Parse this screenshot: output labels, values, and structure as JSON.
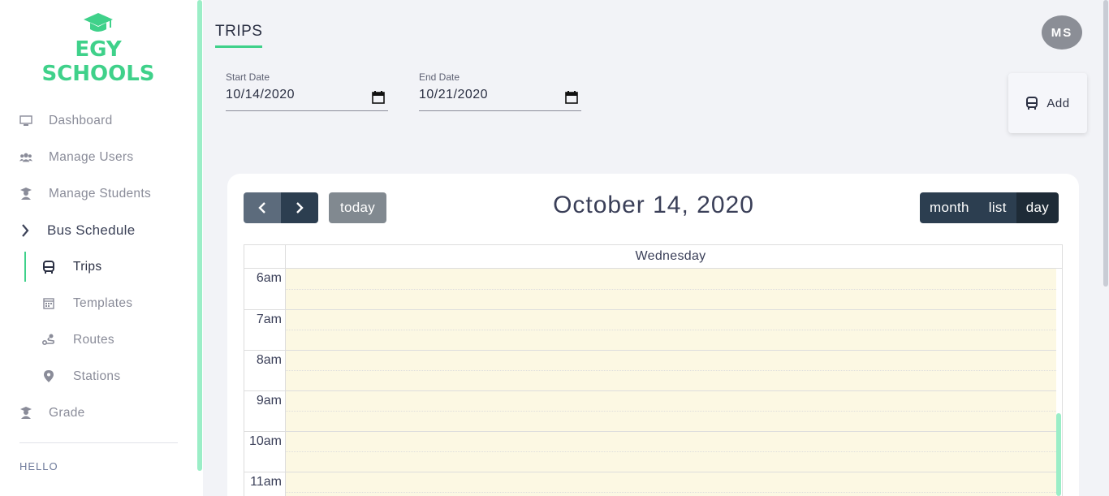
{
  "brand": {
    "name": "EGY SCHOOLS",
    "accent": "#3fd18a"
  },
  "sidebar": {
    "items": [
      {
        "label": "Dashboard",
        "icon": "monitor-icon"
      },
      {
        "label": "Manage Users",
        "icon": "users-icon"
      },
      {
        "label": "Manage Students",
        "icon": "student-icon"
      },
      {
        "label": "Bus Schedule",
        "icon": "chevron-right-icon"
      },
      {
        "label": "Trips",
        "icon": "bus-icon",
        "active": true
      },
      {
        "label": "Templates",
        "icon": "calendar-icon"
      },
      {
        "label": "Routes",
        "icon": "route-icon"
      },
      {
        "label": "Stations",
        "icon": "map-marker-icon"
      },
      {
        "label": "Grade",
        "icon": "student-icon"
      }
    ],
    "footer": "HELLO"
  },
  "header": {
    "title": "TRIPS",
    "avatar_initials": "MS"
  },
  "filters": {
    "start_label": "Start Date",
    "start_value": "10/14/2020",
    "end_label": "End Date",
    "end_value": "10/21/2020"
  },
  "add_button": {
    "label": "Add",
    "icon": "bus-icon"
  },
  "calendar": {
    "today_label": "today",
    "title": "October 14, 2020",
    "views": [
      "month",
      "list",
      "day"
    ],
    "active_view": "day",
    "day_header": "Wednesday",
    "times": [
      "6am",
      "7am",
      "8am",
      "9am",
      "10am",
      "11am"
    ],
    "slot_color": "#fcf8e3"
  }
}
